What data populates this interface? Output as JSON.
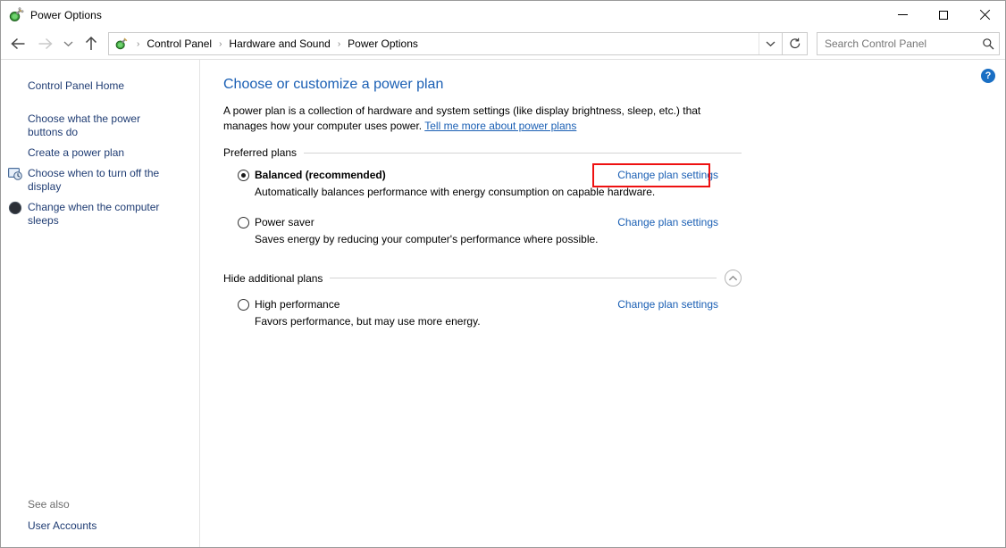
{
  "window": {
    "title": "Power Options",
    "icon": "power-plug-icon",
    "controls": {
      "minimize": "Minimize",
      "maximize": "Maximize",
      "close": "Close"
    }
  },
  "navbar": {
    "back": "Back",
    "forward": "Forward",
    "recent": "Recent locations",
    "up": "Up one level",
    "breadcrumbs": [
      "Control Panel",
      "Hardware and Sound",
      "Power Options"
    ],
    "separator": "›",
    "dropdown": "Previous locations",
    "refresh": "Refresh",
    "search": {
      "placeholder": "Search Control Panel",
      "value": "",
      "icon": "search-icon"
    }
  },
  "sidebar": {
    "home": "Control Panel Home",
    "items": [
      {
        "label": "Choose what the power buttons do",
        "icon": null
      },
      {
        "label": "Create a power plan",
        "icon": null
      },
      {
        "label": "Choose when to turn off the display",
        "icon": "display-clock-icon"
      },
      {
        "label": "Change when the computer sleeps",
        "icon": "moon-sleep-icon"
      }
    ],
    "see_also_label": "See also",
    "see_also_items": [
      "User Accounts"
    ]
  },
  "main": {
    "title": "Choose or customize a power plan",
    "intro_text": "A power plan is a collection of hardware and system settings (like display brightness, sleep, etc.) that manages how your computer uses power. ",
    "intro_link": "Tell me more about power plans",
    "preferred_section": {
      "label": "Preferred plans",
      "plans": [
        {
          "name": "Balanced (recommended)",
          "bold": true,
          "selected": true,
          "description": "Automatically balances performance with energy consumption on capable hardware.",
          "link": "Change plan settings",
          "highlighted": true
        },
        {
          "name": "Power saver",
          "bold": false,
          "selected": false,
          "description": "Saves energy by reducing your computer's performance where possible.",
          "link": "Change plan settings",
          "highlighted": false
        }
      ]
    },
    "additional_section": {
      "label": "Hide additional plans",
      "collapse_icon": "chevron-up-icon",
      "plans": [
        {
          "name": "High performance",
          "bold": false,
          "selected": false,
          "description": "Favors performance, but may use more energy.",
          "link": "Change plan settings",
          "highlighted": false
        }
      ]
    },
    "help_button": "?"
  },
  "colors": {
    "link": "#1a5fb4",
    "sidebar_link": "#1f3c73",
    "highlight": "#ee1111",
    "help_badge": "#1a6fc4",
    "title_heading": "#1a5fb4"
  }
}
